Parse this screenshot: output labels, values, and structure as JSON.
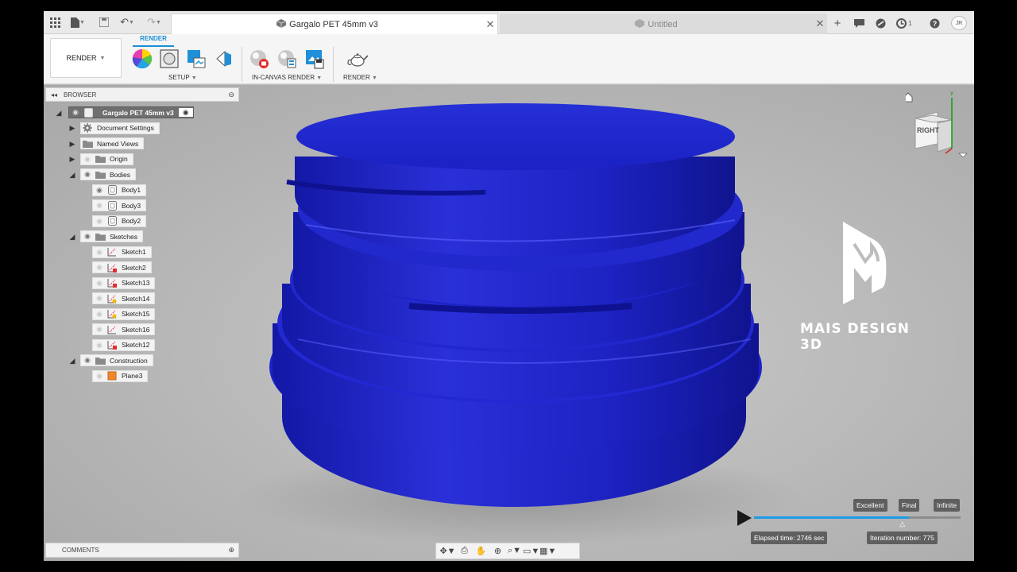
{
  "topbar": {
    "icons": [
      "grid-icon",
      "file-icon",
      "save-icon",
      "undo-icon",
      "redo-icon"
    ],
    "active_tab": "Gargalo PET 45mm v3",
    "inactive_tab": "Untitled",
    "job_count": "1",
    "user_initials": "JR"
  },
  "ribbon": {
    "workspace": "RENDER",
    "tab": "RENDER",
    "groups": {
      "setup": "SETUP",
      "in_canvas": "IN-CANVAS RENDER",
      "render": "RENDER"
    }
  },
  "browser": {
    "title": "BROWSER",
    "root": "Gargalo PET 45mm v3",
    "items": [
      {
        "label": "Document Settings"
      },
      {
        "label": "Named Views"
      },
      {
        "label": "Origin"
      },
      {
        "label": "Bodies"
      },
      {
        "label": "Body1"
      },
      {
        "label": "Body3"
      },
      {
        "label": "Body2"
      },
      {
        "label": "Sketches"
      },
      {
        "label": "Sketch1"
      },
      {
        "label": "Sketch2"
      },
      {
        "label": "Sketch13"
      },
      {
        "label": "Sketch14"
      },
      {
        "label": "Sketch15"
      },
      {
        "label": "Sketch16"
      },
      {
        "label": "Sketch12"
      },
      {
        "label": "Construction"
      },
      {
        "label": "Plane3"
      }
    ]
  },
  "comments": {
    "title": "COMMENTS"
  },
  "viewcube": {
    "face": "RIGHT"
  },
  "logo": {
    "text": "MAIS DESIGN 3D"
  },
  "render_progress": {
    "quality_labels": [
      "Excellent",
      "Final",
      "Infinite"
    ],
    "progress_fraction": 0.75,
    "elapsed": "Elapsed time: 2746 sec",
    "iteration": "Iteration number: 775"
  },
  "colors": {
    "model": "#1a1fb8",
    "accent": "#1e9be8"
  }
}
